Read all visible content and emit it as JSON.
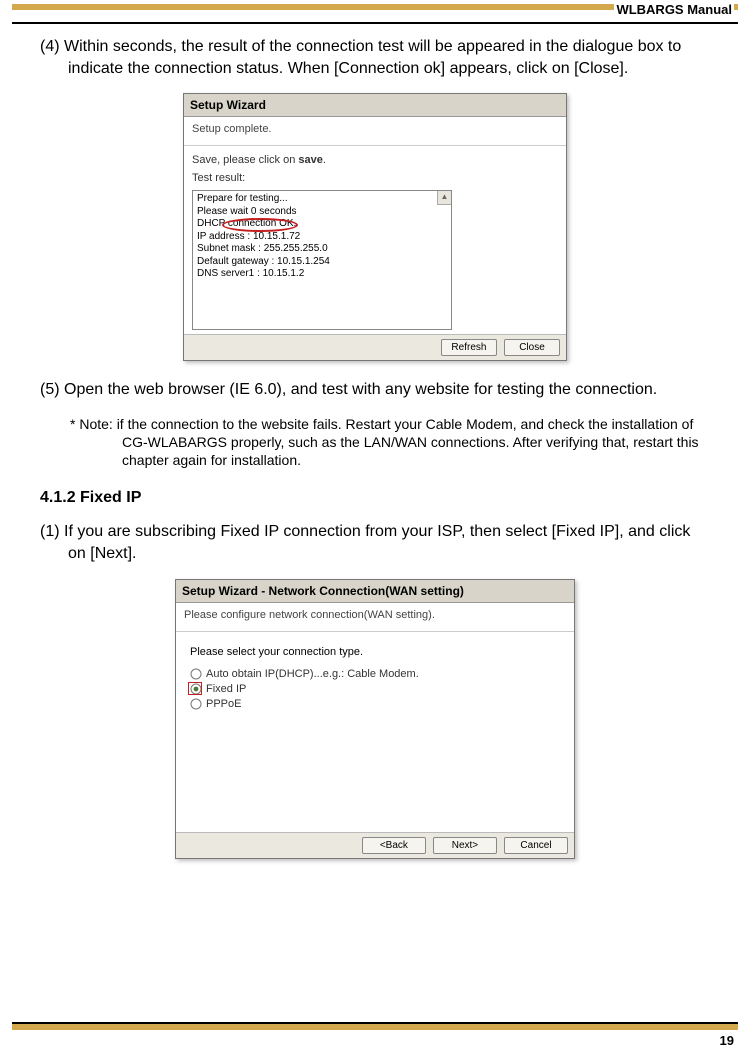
{
  "header": {
    "title": "WLBARGS Manual"
  },
  "page_number": "19",
  "step4": "(4) Within seconds, the result of the connection test will be appeared in the dialogue box to indicate the connection status. When [Connection ok] appears, click on [Close].",
  "step5": "(5) Open the web browser (IE 6.0), and test with any website for testing the connection.",
  "note": "* Note: if the connection to the website fails. Restart your Cable Modem, and check the installation of CG-WLABARGS properly, such as the LAN/WAN connections. After verifying that, restart this chapter again for installation.",
  "section": "4.1.2 Fixed IP",
  "step1": "(1) If you are subscribing Fixed IP connection from your ISP, then select [Fixed IP], and click on [Next].",
  "wizard1": {
    "title": "Setup Wizard",
    "subtitle": "Setup complete.",
    "save_prefix": "Save, please click on ",
    "save_strong": "save",
    "save_suffix": ".",
    "test_label": "Test result:",
    "results": [
      "Prepare for testing...",
      "Please wait 0 seconds",
      "DHCP connection OK.",
      "IP address : 10.15.1.72",
      "Subnet mask : 255.255.255.0",
      "Default gateway : 10.15.1.254",
      "DNS server1 : 10.15.1.2"
    ],
    "btn_refresh": "Refresh",
    "btn_close": "Close"
  },
  "wizard2": {
    "title": "Setup Wizard - Network Connection(WAN setting)",
    "subtitle": "Please configure network connection(WAN setting).",
    "select_label": "Please select your connection type.",
    "opt_dhcp": "Auto obtain IP(DHCP)...e.g.: Cable Modem.",
    "opt_fixed": "Fixed IP",
    "opt_pppoe": "PPPoE",
    "btn_back": "<Back",
    "btn_next": "Next>",
    "btn_cancel": "Cancel"
  }
}
